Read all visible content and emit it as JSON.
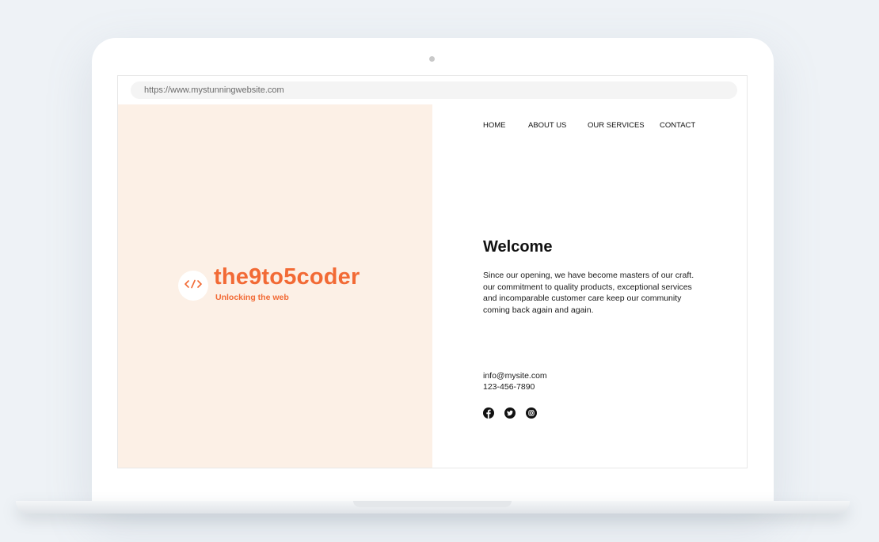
{
  "browser": {
    "url": "https://www.mystunningwebsite.com"
  },
  "brand": {
    "name": "the9to5coder",
    "tagline": "Unlocking the web",
    "logo_icon": "code-icon",
    "accent_color": "#f26a35",
    "panel_color": "#fcf0e6"
  },
  "nav": {
    "items": [
      {
        "label": "HOME"
      },
      {
        "label": "ABOUT US"
      },
      {
        "label": "OUR SERVICES"
      },
      {
        "label": "CONTACT"
      }
    ]
  },
  "hero": {
    "title": "Welcome",
    "lines": [
      "Since our opening, we have become masters of our craft.",
      "our commitment to quality products, exceptional services",
      "and incomparable customer care keep our community",
      "coming back again and again."
    ]
  },
  "contact": {
    "email": "info@mysite.com",
    "phone": "123-456-7890"
  },
  "social": {
    "icons": [
      "facebook-icon",
      "twitter-icon",
      "instagram-icon"
    ]
  }
}
